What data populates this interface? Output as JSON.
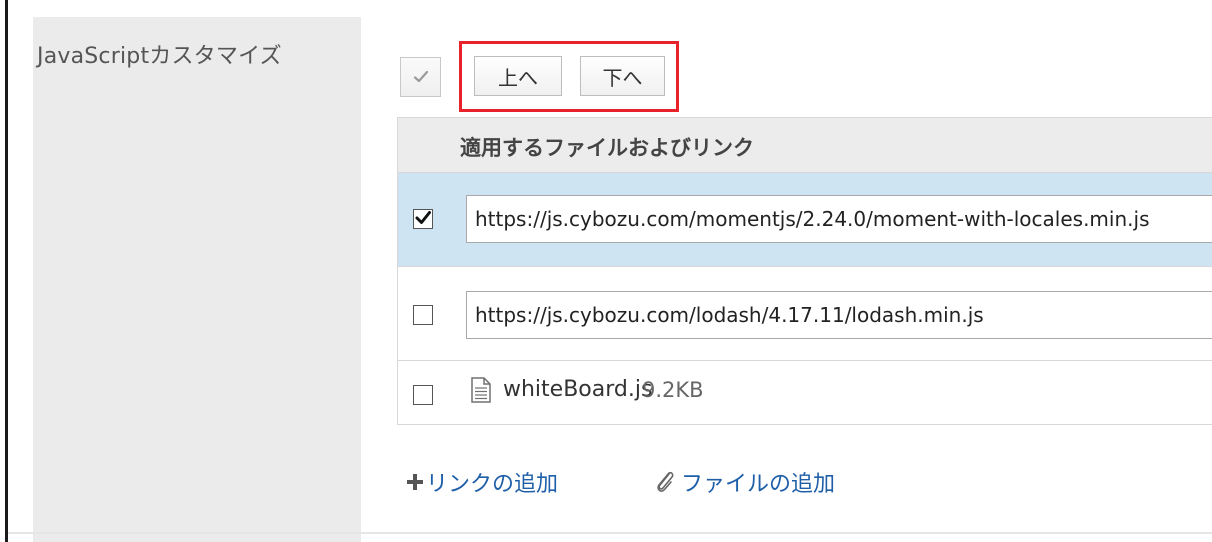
{
  "setting": {
    "label": "JavaScriptカスタマイズ"
  },
  "toolbar": {
    "up_label": "上へ",
    "down_label": "下へ"
  },
  "table": {
    "header": "適用するファイルおよびリンク",
    "rows": [
      {
        "checked": true,
        "type": "link",
        "value": "https://js.cybozu.com/momentjs/2.24.0/moment-with-locales.min.js"
      },
      {
        "checked": false,
        "type": "link",
        "value": "https://js.cybozu.com/lodash/4.17.11/lodash.min.js"
      },
      {
        "checked": false,
        "type": "file",
        "name": "whiteBoard.js",
        "size": "9.2KB"
      }
    ]
  },
  "actions": {
    "add_link": "リンクの追加",
    "add_file": "ファイルの追加"
  },
  "colors": {
    "highlight": "#e8212b",
    "selected_row": "#cfe4f2",
    "link": "#1f5fa8"
  }
}
